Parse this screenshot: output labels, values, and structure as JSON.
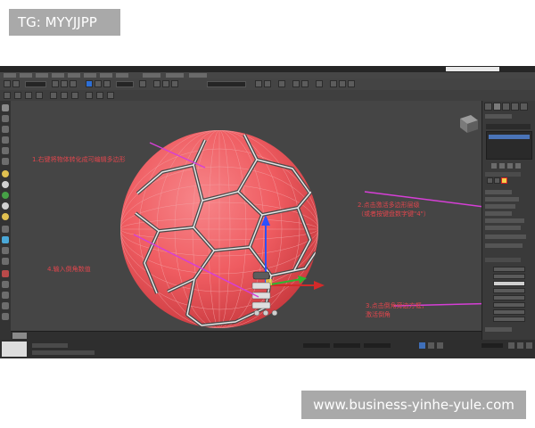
{
  "watermark_top": "TG: MYYJJPP",
  "watermark_bottom": "www.business-yinhe-yule.com",
  "annotations": {
    "step1": "1.右键将物体转化成可编辑多边形",
    "step2_line1": "2.点击激活多边形层级",
    "step2_line2": "（或者按键盘数字键\"4\"）",
    "step3_line1": "3.点击倒角旁边方框，",
    "step3_line2": "激活倒角",
    "step4": "4.输入倒角数值"
  },
  "colors": {
    "viewport_bg": "#454545",
    "ball_red": "#ef5c61",
    "annotation_red": "#e0464d",
    "annotation_line": "#d63fd6",
    "ui_dark": "#3a3a3a"
  },
  "icons": [
    "gizmo-move-icon",
    "caddy-bevel-icon",
    "viewcube-icon"
  ]
}
